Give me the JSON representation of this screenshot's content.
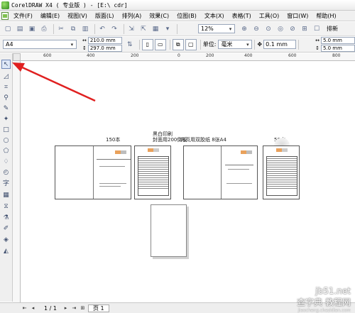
{
  "window": {
    "title": "CorelDRAW X4 ( 专业版 ) - [E:\\             cdr]"
  },
  "menu": [
    "文件(F)",
    "编辑(E)",
    "视图(V)",
    "版面(L)",
    "排列(A)",
    "效果(C)",
    "位图(B)",
    "文本(X)",
    "表格(T)",
    "工具(O)",
    "窗口(W)",
    "帮助(H)"
  ],
  "toolbar1": {
    "zoom": "12%",
    "paste_new_label": "排新"
  },
  "toolbar2": {
    "paper_size": "A4",
    "width": "210.0 mm",
    "height": "297.0 mm",
    "units_label": "单位:",
    "units": "毫米",
    "nudge": "0.1 mm",
    "dup_x": "5.0 mm",
    "dup_y": "5.0 mm"
  },
  "ruler": {
    "top_ticks": [
      "600",
      "400",
      "200",
      "0",
      "200",
      "400",
      "600",
      "800"
    ]
  },
  "canvas": {
    "label_150": "150本",
    "label_bw": "黑白印刷",
    "label_cover": "封面用200倒板",
    "label_inner": "内页用双胶纸 8张A4",
    "label_50": "50本"
  },
  "status": {
    "page_count": "1 / 1",
    "page_tab": "页 1"
  },
  "watermark": {
    "line1": "查字典 教程网",
    "line2": "jiaocheng.chazidian.com",
    "site": "jb51.net"
  },
  "colors": {
    "annotation_arrow": "#e02020",
    "accent_orange": "#e9a15b"
  }
}
